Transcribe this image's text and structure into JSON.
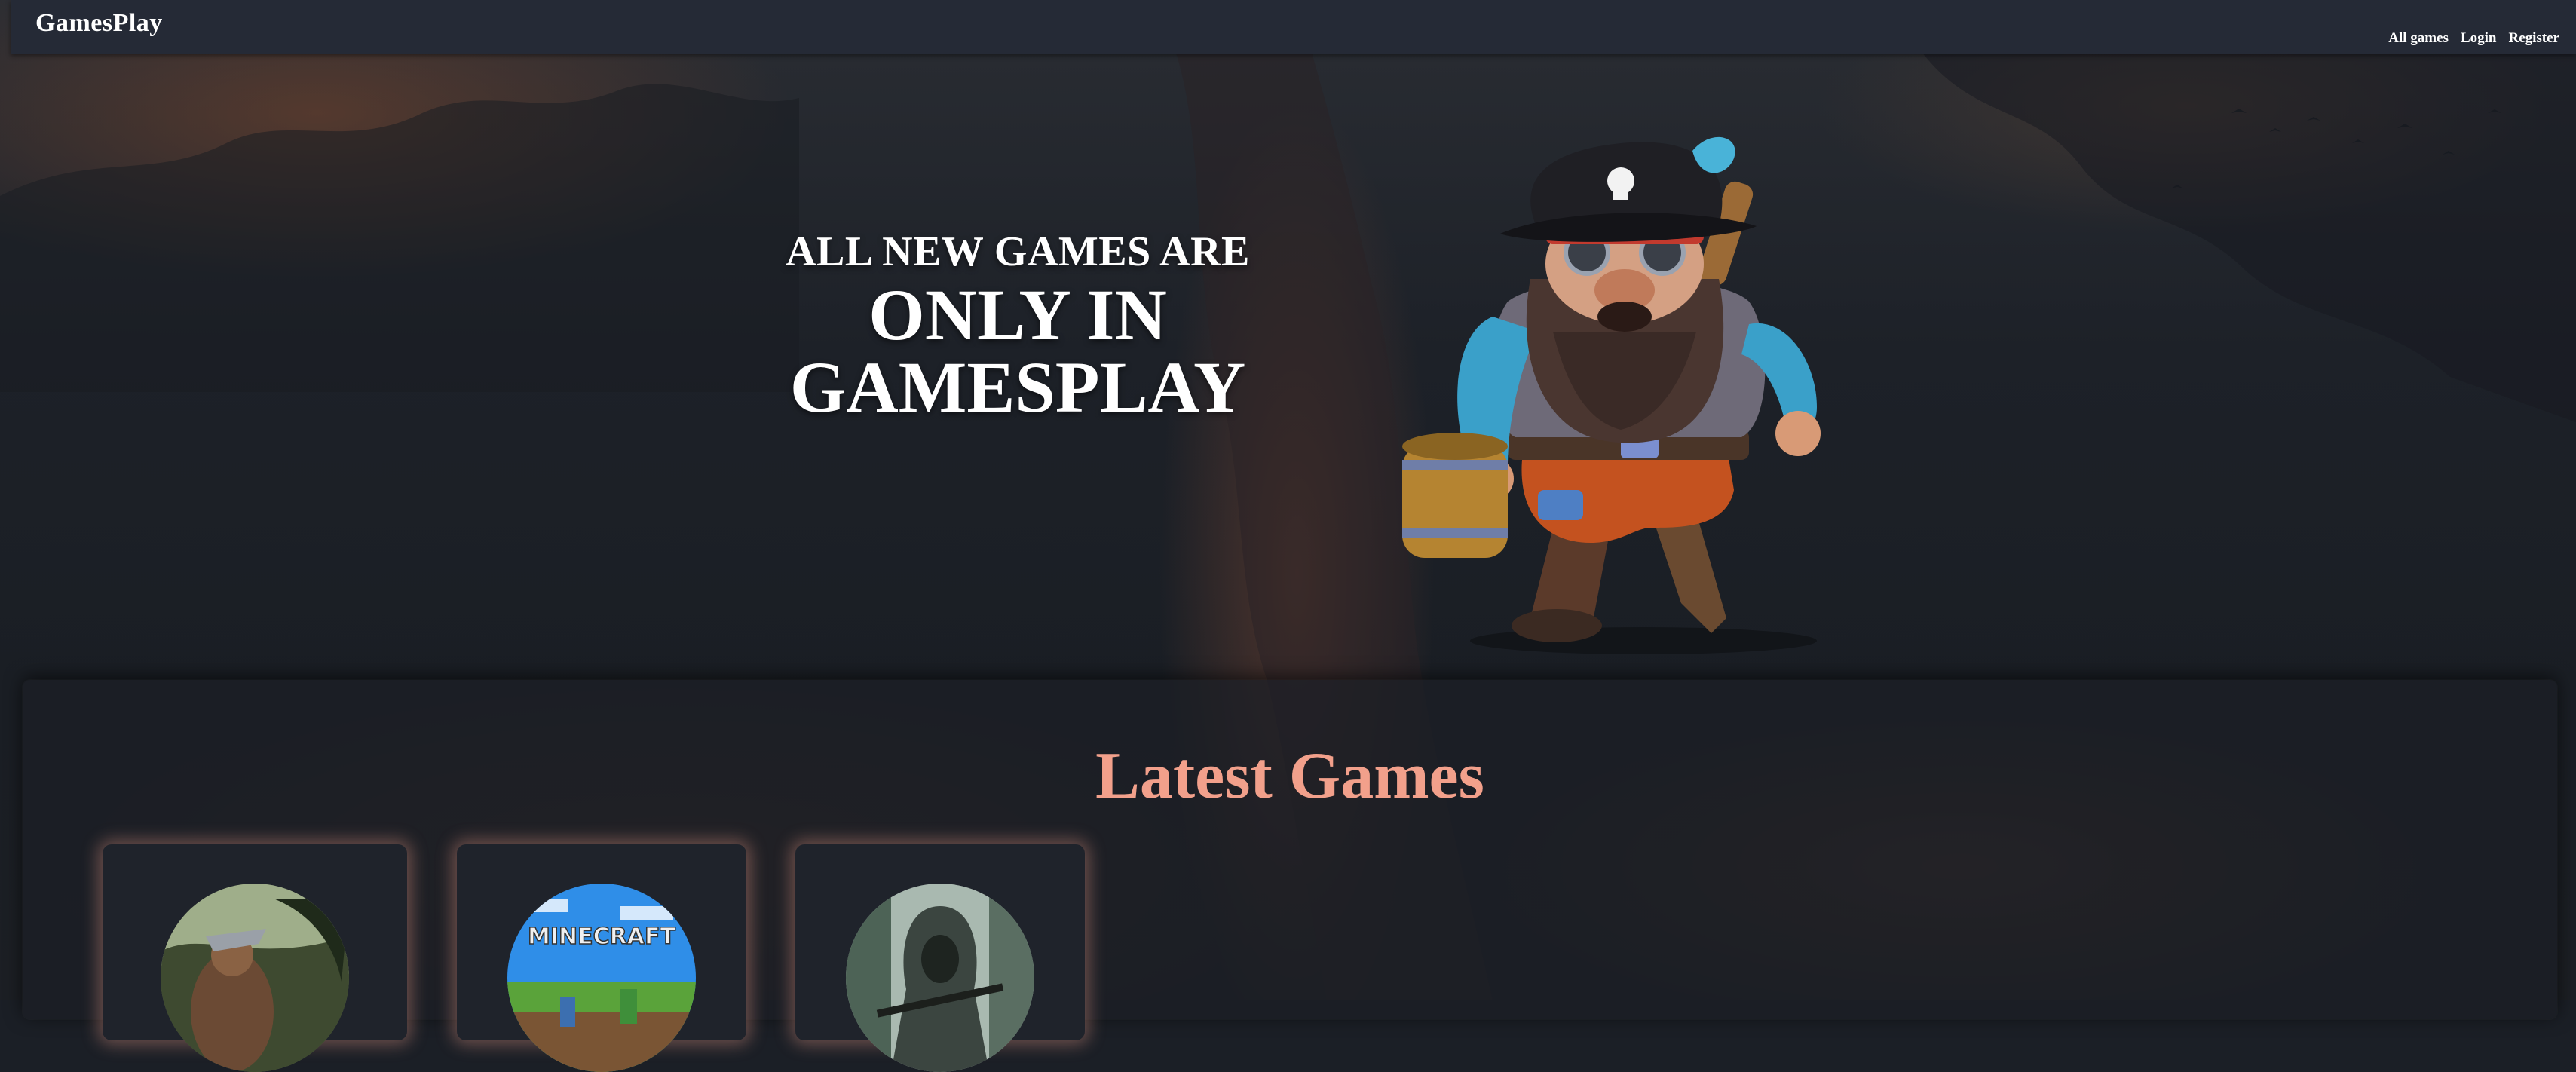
{
  "header": {
    "brand": "GamesPlay",
    "nav": [
      {
        "label": "All games"
      },
      {
        "label": "Login"
      },
      {
        "label": "Register"
      }
    ]
  },
  "hero": {
    "line1": "ALL NEW GAMES ARE",
    "line2": "ONLY IN",
    "line3": "GAMESPLAY",
    "image": "pirate-dwarf-character"
  },
  "latest": {
    "title": "Latest Games",
    "games": [
      {
        "thumbnail": "jungle-warrior-artwork"
      },
      {
        "thumbnail": "minecraft-cover",
        "logo_text": "MINECRAFT"
      },
      {
        "thumbnail": "hooded-sniper-artwork"
      }
    ]
  },
  "colors": {
    "header_bg": "#252a36",
    "accent": "#f2a08b",
    "page_bg": "#1b1f26"
  }
}
